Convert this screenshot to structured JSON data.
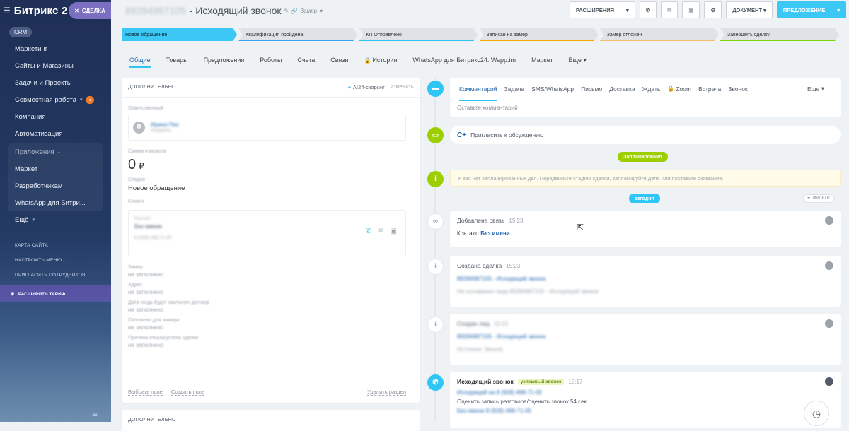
{
  "sidebar": {
    "logo": "Битрикс 2",
    "deal_button": "СДЕЛКА",
    "crm": "CRM",
    "items": [
      {
        "label": "Маркетинг"
      },
      {
        "label": "Сайты и Магазины"
      },
      {
        "label": "Задачи и Проекты"
      },
      {
        "label": "Совместная работа",
        "badge": "3"
      },
      {
        "label": "Компания"
      },
      {
        "label": "Автоматизация"
      }
    ],
    "apps_header": "Приложения",
    "apps": [
      {
        "label": "Маркет"
      },
      {
        "label": "Разработчикам"
      },
      {
        "label": "WhatsApp для Битри..."
      }
    ],
    "more": "Ещё",
    "links": [
      "КАРТА САЙТА",
      "НАСТРОИТЬ МЕНЮ",
      "ПРИГЛАСИТЬ СОТРУДНИКОВ"
    ],
    "upgrade": "РАСШИРИТЬ ТАРИФ"
  },
  "header": {
    "phone": "89284987105",
    "title": "- Исходящий звонок",
    "subtitle": "Замер",
    "btn_extensions": "РАСШИРЕНИЯ",
    "btn_document": "ДОКУМЕНТ",
    "btn_offer": "ПРЕДЛОЖЕНИЕ"
  },
  "stages": [
    {
      "label": "Новое обращение",
      "active": true,
      "color": "#3bc8f5"
    },
    {
      "label": "Квалификация пройдена",
      "active": false,
      "color": "#39a8ef"
    },
    {
      "label": "КП Отправлено",
      "active": false,
      "color": "#2fc6f6"
    },
    {
      "label": "Записан на замер",
      "active": false,
      "color": "#f7a700"
    },
    {
      "label": "Замер отложен",
      "active": false,
      "color": "#f3c06d"
    },
    {
      "label": "Завершить сделку",
      "active": false,
      "color": "#7bd500"
    }
  ],
  "tabs": [
    {
      "label": "Общие",
      "active": true
    },
    {
      "label": "Товары"
    },
    {
      "label": "Предложения"
    },
    {
      "label": "Роботы"
    },
    {
      "label": "Счета"
    },
    {
      "label": "Связи"
    },
    {
      "label": "История",
      "locked": true
    },
    {
      "label": "WhatsApp для Битрикс24. Wapp.im"
    },
    {
      "label": "Маркет"
    },
    {
      "label": "Еще"
    }
  ],
  "left_card": {
    "header": "ДОПОЛНИТЕЛЬНО",
    "ai_link": "AI24-скоринг",
    "change": "изменить",
    "responsible_label": "Ответственный",
    "responsible_name": "Ирина Пас",
    "responsible_role": "продавец",
    "sum_label": "Сумма и валюта",
    "sum_value": "0",
    "currency": "₽",
    "stage_label": "Стадия",
    "stage_value": "Новое обращение",
    "client_label": "Клиент",
    "client_type": "Контакт",
    "client_name": "Без имени",
    "client_phone": "8 (928) 498-71-05",
    "fields": [
      {
        "label": "Замер",
        "value": "не заполнено"
      },
      {
        "label": "Адрес",
        "value": "не заполнено"
      },
      {
        "label": "Дата когда будет заключен договор",
        "value": "не заполнено"
      },
      {
        "label": "Отложено для замера",
        "value": "не заполнено"
      },
      {
        "label": "Причина отказа/успеха сделки",
        "value": "не заполнено"
      }
    ],
    "select_field": "Выбрать поле",
    "create_field": "Создать поле",
    "delete_section": "Удалить раздел",
    "second_header": "ДОПОЛНИТЕЛЬНО"
  },
  "editor": {
    "tabs": [
      "Комментарий",
      "Задача",
      "SMS/WhatsApp",
      "Письмо",
      "Доставка",
      "Ждать",
      "Zoom",
      "Встреча",
      "Звонок"
    ],
    "more": "Еще",
    "placeholder": "Оставьте комментарий"
  },
  "invite": "Пригласить к обсуждению",
  "planned": "Запланировано",
  "notice": "У вас нет запланированных дел. Передвиньте стадию сделки, запланируйте дело или поставьте ожидание.",
  "today": "сегодня",
  "filter": "ФИЛЬТР",
  "timeline": [
    {
      "title": "Добавлена связь",
      "time": "15:23",
      "line_label": "Контакт:",
      "line_value": "Без имени"
    },
    {
      "title": "Создана сделка",
      "time": "15:23",
      "line1": "89284987105 - Исходящий звонок",
      "line2": "На основании лида 89284987105 - Исходящий звонок"
    },
    {
      "title": "Создан лид",
      "time": "15:23",
      "line1": "89284987105 - Исходящий звонок",
      "line2": "Источник: Звонок"
    },
    {
      "title": "Исходящий звонок",
      "badge": "успешный звонок",
      "time": "15:17",
      "line1": "Исходящий на 8 (928) 498-71-05",
      "line2": "Оценить запись разговора/оценить звонок 54 сек.",
      "line3": "Без имени 8 (928) 498-71-05"
    }
  ]
}
